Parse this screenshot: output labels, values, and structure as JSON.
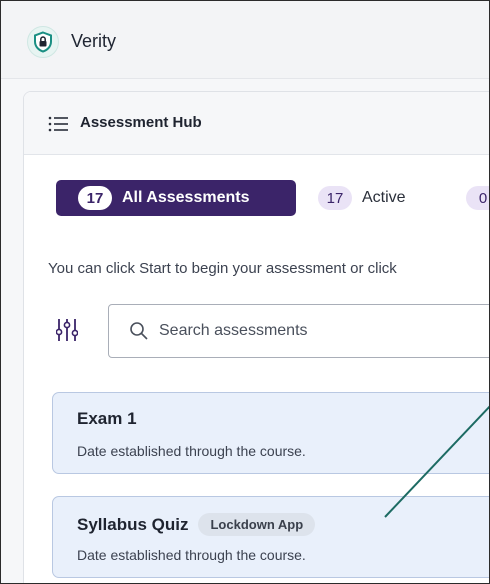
{
  "app": {
    "name": "Verity",
    "logo_icon": "shield-lock-icon",
    "accent": "#1a8f83"
  },
  "hub": {
    "title": "Assessment Hub",
    "menu_icon": "list-menu-icon"
  },
  "tabs": [
    {
      "count": "17",
      "label": "All Assessments",
      "selected": true
    },
    {
      "count": "17",
      "label": "Active",
      "selected": false
    },
    {
      "count": "0",
      "label": "",
      "selected": false
    }
  ],
  "instruction": "You can click Start to begin your assessment or click",
  "search": {
    "placeholder": "Search assessments",
    "value": ""
  },
  "filter_icon": "filter-sliders-icon",
  "assessments": [
    {
      "title": "Exam 1",
      "badge": "",
      "subtitle": "Date established through the course."
    },
    {
      "title": "Syllabus Quiz",
      "badge": "Lockdown App",
      "subtitle": "Date established through the course."
    }
  ],
  "colors": {
    "tab_selected_bg": "#3b2469",
    "item_bg": "#e9f0fb",
    "annotation_line": "#1d6b63"
  }
}
